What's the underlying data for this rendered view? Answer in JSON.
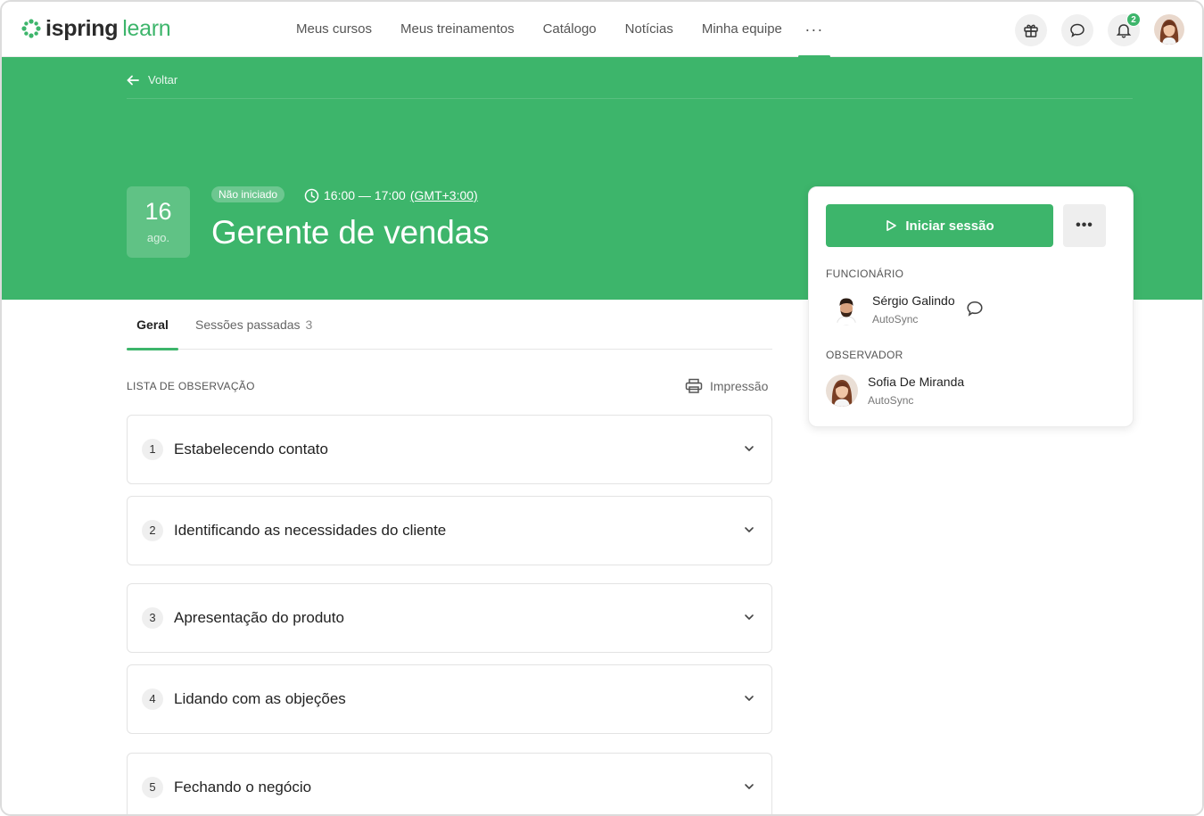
{
  "header": {
    "logo_primary": "ispring",
    "logo_secondary": "learn",
    "nav": [
      "Meus cursos",
      "Meus treinamentos",
      "Catálogo",
      "Notícias",
      "Minha equipe"
    ],
    "more_label": "···",
    "notifications_count": "2",
    "icons": [
      "gift-icon",
      "chat-icon",
      "bell-icon"
    ]
  },
  "hero": {
    "back_label": "Voltar",
    "date_day": "16",
    "date_month": "ago.",
    "status": "Não iniciado",
    "time_range": "16:00 — 17:00",
    "timezone": "(GMT+3:00)",
    "title": "Gerente de vendas"
  },
  "card": {
    "start_label": "Iniciar sessão",
    "more_label": "•••",
    "employee_label": "FUNCIONÁRIO",
    "employee": {
      "name": "Sérgio Galindo",
      "org": "AutoSync"
    },
    "observer_label": "OBSERVADOR",
    "observer": {
      "name": "Sofia De Miranda",
      "org": "AutoSync"
    }
  },
  "tabs": {
    "general": "Geral",
    "past": "Sessões passadas",
    "past_count": "3"
  },
  "checklist": {
    "label": "LISTA DE OBSERVAÇÃO",
    "print_label": "Impressão",
    "items": [
      {
        "number": "1",
        "title": "Estabelecendo contato"
      },
      {
        "number": "2",
        "title": "Identificando as necessidades do cliente"
      },
      {
        "number": "3",
        "title": "Apresentação do produto"
      },
      {
        "number": "4",
        "title": "Lidando com as objeções"
      },
      {
        "number": "5",
        "title": "Fechando o negócio"
      }
    ]
  },
  "colors": {
    "brand": "#3db56b",
    "text": "#2b2b2b"
  }
}
